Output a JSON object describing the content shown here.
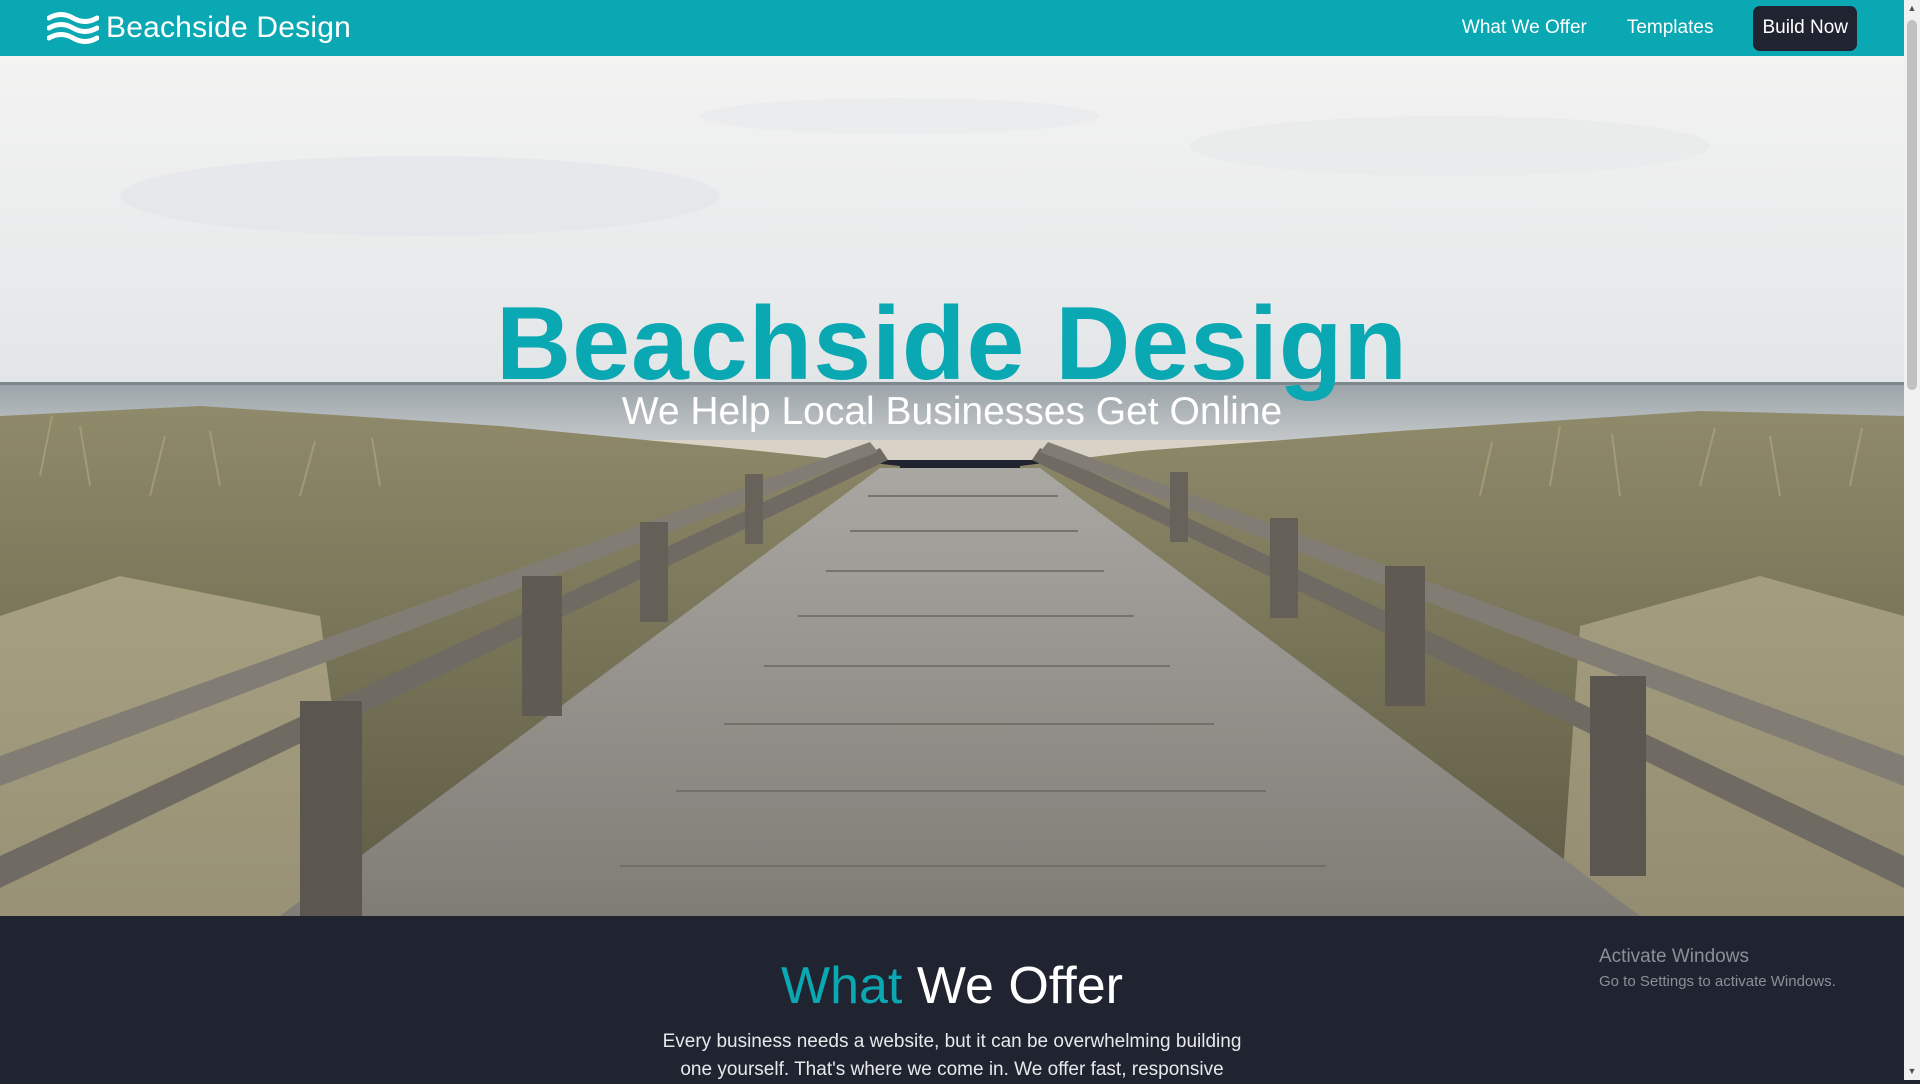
{
  "nav": {
    "brand_name": "Beachside Design",
    "links": [
      "What We Offer",
      "Templates"
    ],
    "cta_label": "Build Now"
  },
  "hero": {
    "title": "Beachside Design",
    "subtitle": "We Help Local Businesses Get Online"
  },
  "offer": {
    "heading_accent": "What",
    "heading_rest": " We Offer",
    "body": "Every business needs a website, but it can be overwhelming building one yourself. That's where we come in. We offer fast, responsive"
  },
  "watermark": {
    "title": "Activate Windows",
    "subtitle": "Go to Settings to activate Windows."
  },
  "colors": {
    "brand_teal": "#0aa8b2",
    "dark_bg": "#1f2430",
    "white": "#ffffff"
  },
  "icons": {
    "logo": "waves-logo-icon",
    "scroll_up": "chevron-up-icon",
    "scroll_down": "chevron-down-icon"
  }
}
